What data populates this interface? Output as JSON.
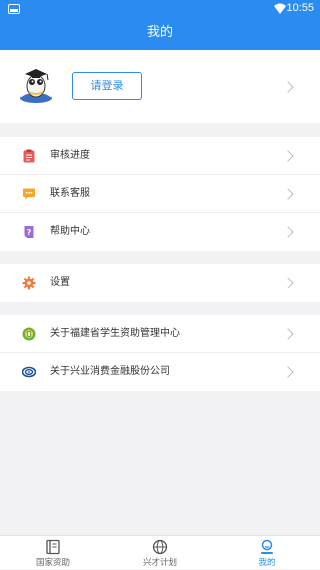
{
  "status_bar": {
    "time": "10:55"
  },
  "header": {
    "title": "我的"
  },
  "profile": {
    "login_label": "请登录"
  },
  "groups": [
    {
      "items": [
        {
          "label": "审核进度",
          "icon": "clipboard-icon",
          "color": "#e85a5a"
        },
        {
          "label": "联系客服",
          "icon": "chat-icon",
          "color": "#f5a623"
        },
        {
          "label": "帮助中心",
          "icon": "question-icon",
          "color": "#9b6bd6"
        }
      ]
    },
    {
      "items": [
        {
          "label": "设置",
          "icon": "gear-icon",
          "color": "#f07a3a"
        }
      ]
    },
    {
      "items": [
        {
          "label": "关于福建省学生资助管理中心",
          "icon": "fj-logo-icon",
          "color": "#6cb33e"
        },
        {
          "label": "关于兴业消费金融股份公司",
          "icon": "cib-logo-icon",
          "color": "#1e4fa0"
        }
      ]
    }
  ],
  "tabs": [
    {
      "label": "国家资助",
      "icon": "book-icon",
      "active": false
    },
    {
      "label": "兴才计划",
      "icon": "globe-icon",
      "active": false
    },
    {
      "label": "我的",
      "icon": "person-icon",
      "active": true
    }
  ],
  "colors": {
    "primary": "#2a8cf0",
    "background": "#f2f2f5"
  }
}
